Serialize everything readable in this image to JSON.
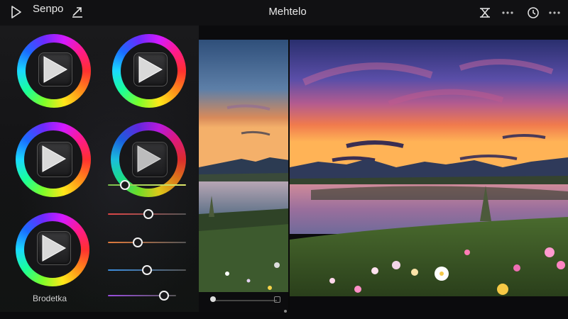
{
  "app": {
    "name": "Senpo",
    "title": "Mehtelo"
  },
  "toolbar": {
    "left_icons": [
      "play-outline-icon",
      "share-arrow-icon"
    ],
    "right_icons": [
      "crop-icon",
      "more-dots-icon",
      "timer-icon",
      "more-dots-icon"
    ]
  },
  "panel": {
    "wheel_label": "Brodetka",
    "wheels": [
      {
        "id": "top-left"
      },
      {
        "id": "top-right"
      },
      {
        "id": "middle-left"
      },
      {
        "id": "middle-right"
      },
      {
        "id": "bottom-left"
      }
    ],
    "sliders": [
      {
        "name": "green-slider",
        "value": 0.22,
        "color": "#a8e65b"
      },
      {
        "name": "red-slider",
        "value": 0.52,
        "color": "#e04646"
      },
      {
        "name": "orange-slider",
        "value": 0.38,
        "color": "#e07a3c"
      },
      {
        "name": "blue-slider",
        "value": 0.5,
        "color": "#3c8ee0"
      },
      {
        "name": "purple-slider",
        "value": 0.82,
        "color": "#9a4de0"
      }
    ]
  },
  "scrubber": {
    "value": 0.0
  },
  "colors": {
    "background": "#0b0b0d",
    "topbar": "#111113",
    "accent": "#ff9a3c"
  }
}
